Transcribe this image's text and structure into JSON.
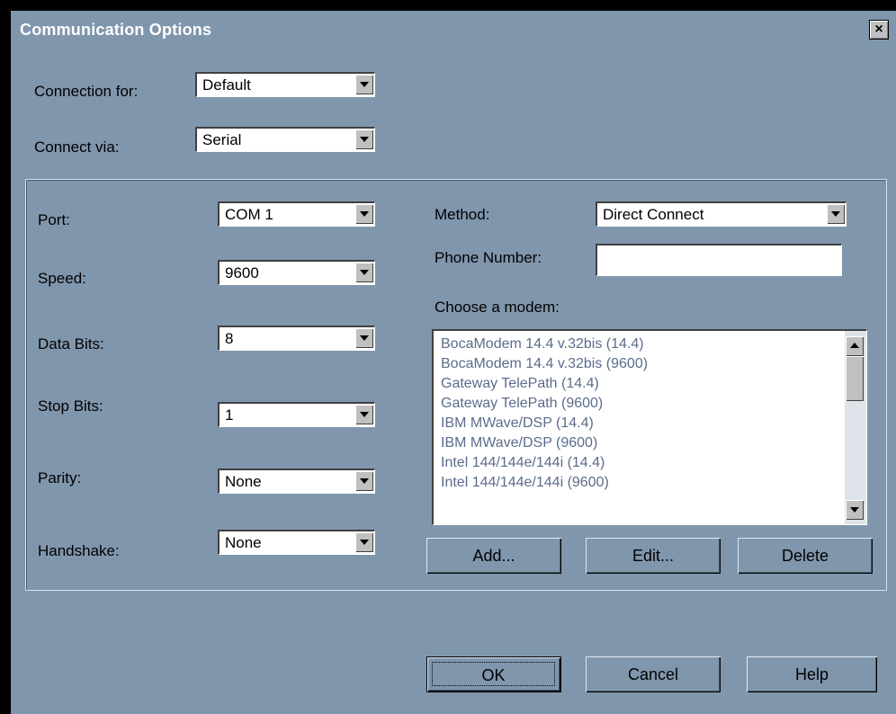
{
  "window": {
    "title": "Communication Options",
    "close_symbol": "×"
  },
  "connection_for": {
    "label": "Connection for:",
    "value": "Default"
  },
  "connect_via": {
    "label": "Connect via:",
    "value": "Serial"
  },
  "serial": {
    "port": {
      "label": "Port:",
      "value": "COM 1"
    },
    "speed": {
      "label": "Speed:",
      "value": "9600"
    },
    "data_bits": {
      "label": "Data Bits:",
      "value": "8"
    },
    "stop_bits": {
      "label": "Stop Bits:",
      "value": "1"
    },
    "parity": {
      "label": "Parity:",
      "value": "None"
    },
    "handshake": {
      "label": "Handshake:",
      "value": "None"
    }
  },
  "modem": {
    "method": {
      "label": "Method:",
      "value": "Direct Connect"
    },
    "phone": {
      "label": "Phone Number:",
      "value": ""
    },
    "choose_label": "Choose a modem:",
    "items": [
      "BocaModem 14.4 v.32bis (14.4)",
      "BocaModem 14.4 v.32bis (9600)",
      "Gateway TelePath (14.4)",
      "Gateway TelePath (9600)",
      "IBM MWave/DSP (14.4)",
      "IBM MWave/DSP (9600)",
      "Intel 144/144e/144i (14.4)",
      "Intel 144/144e/144i (9600)"
    ],
    "add_label": "Add...",
    "edit_label": "Edit...",
    "delete_label": "Delete"
  },
  "footer": {
    "ok_label": "OK",
    "cancel_label": "Cancel",
    "help_label": "Help"
  },
  "colors": {
    "background": "#8096ad",
    "title_text": "#ffffff",
    "list_text": "#5b6c8c"
  }
}
